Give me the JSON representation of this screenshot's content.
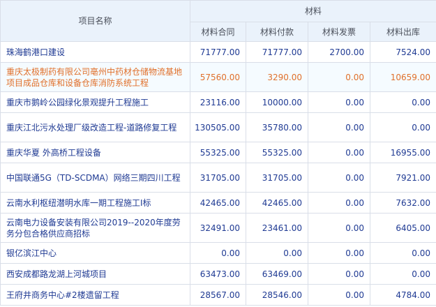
{
  "header": {
    "project_name": "项目名称",
    "group_label": "材料",
    "columns": [
      "材料合同",
      "材料付款",
      "材料发票",
      "材料出库"
    ]
  },
  "rows": [
    {
      "name": "珠海鹤港口建设",
      "contract": "71777.00",
      "payment": "71777.00",
      "invoice": "2700.00",
      "outbound": "7524.00",
      "highlighted": false
    },
    {
      "name": "重庆太极制药有限公司亳州中药材仓储物流基地项目成品仓库和设备仓库消防系统工程",
      "contract": "57560.00",
      "payment": "3290.00",
      "invoice": "0.00",
      "outbound": "10659.00",
      "highlighted": true
    },
    {
      "name": "重庆市鹅岭公园绿化景观提升工程施工",
      "contract": "23116.00",
      "payment": "10000.00",
      "invoice": "0.00",
      "outbound": "0.00",
      "highlighted": false
    },
    {
      "name": "重庆江北污水处理厂级改造工程-道路修复工程",
      "contract": "130505.00",
      "payment": "35780.00",
      "invoice": "0.00",
      "outbound": "0.00",
      "highlighted": false
    },
    {
      "name": "重庆华夏 外高桥工程设备",
      "contract": "55325.00",
      "payment": "55325.00",
      "invoice": "0.00",
      "outbound": "16955.00",
      "highlighted": false
    },
    {
      "name": "中国联通5G（TD-SCDMA）网络三期四川工程",
      "contract": "31705.00",
      "payment": "31705.00",
      "invoice": "0.00",
      "outbound": "7921.00",
      "highlighted": false
    },
    {
      "name": "云南水利枢纽潜明水库一期工程施工I标",
      "contract": "42465.00",
      "payment": "42465.00",
      "invoice": "0.00",
      "outbound": "7632.00",
      "highlighted": false
    },
    {
      "name": "云南电力设备安装有限公司2019--2020年度劳务分包合格供应商招标",
      "contract": "32491.00",
      "payment": "23461.00",
      "invoice": "0.00",
      "outbound": "6405.00",
      "highlighted": false
    },
    {
      "name": "银亿滨江中心",
      "contract": "0.00",
      "payment": "0.00",
      "invoice": "0.00",
      "outbound": "0.00",
      "highlighted": false
    },
    {
      "name": "西安成都路龙湖上河城项目",
      "contract": "63473.00",
      "payment": "63469.00",
      "invoice": "0.00",
      "outbound": "0.00",
      "highlighted": false
    },
    {
      "name": "王府井商务中心#2楼遗留工程",
      "contract": "28567.00",
      "payment": "28546.00",
      "invoice": "0.00",
      "outbound": "4784.00",
      "highlighted": false
    }
  ]
}
